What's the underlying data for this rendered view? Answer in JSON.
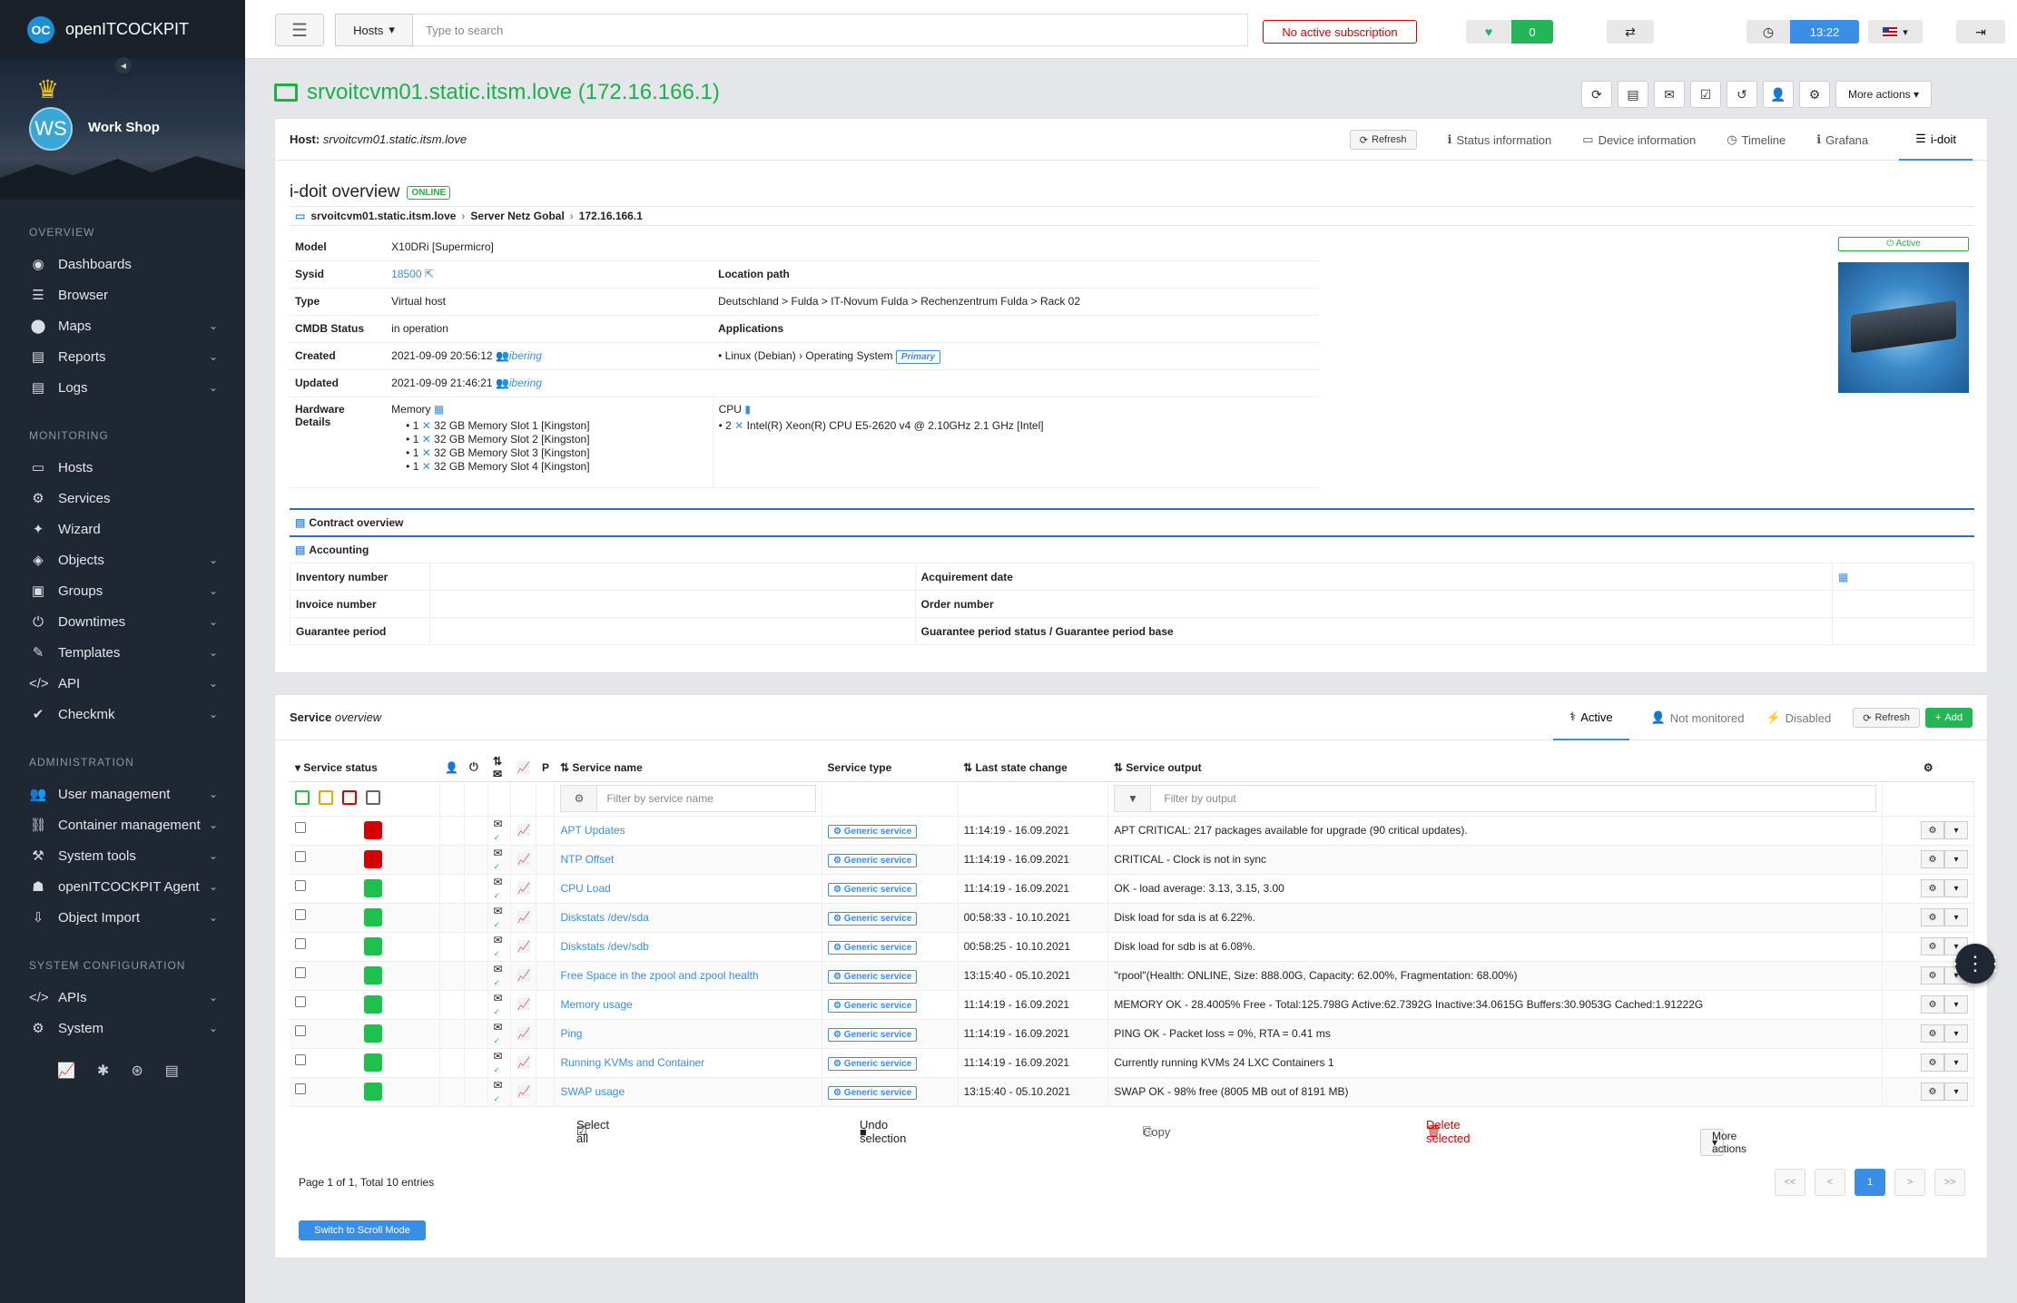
{
  "app": {
    "name": "openITCOCKPIT",
    "logo_text": "OC"
  },
  "user": {
    "initials": "WS",
    "name": "Work Shop"
  },
  "sidebar": {
    "sections": [
      {
        "title": "OVERVIEW",
        "items": [
          {
            "label": "Dashboards",
            "icon": "dashboard-icon",
            "glyph": "◉",
            "expandable": false
          },
          {
            "label": "Browser",
            "icon": "list-icon",
            "glyph": "☰",
            "expandable": false
          },
          {
            "label": "Maps",
            "icon": "map-marker-icon",
            "glyph": "⬤",
            "expandable": true
          },
          {
            "label": "Reports",
            "icon": "file-icon",
            "glyph": "▤",
            "expandable": true
          },
          {
            "label": "Logs",
            "icon": "file-text-icon",
            "glyph": "▤",
            "expandable": true
          }
        ]
      },
      {
        "title": "MONITORING",
        "items": [
          {
            "label": "Hosts",
            "icon": "desktop-icon",
            "glyph": "▭",
            "expandable": false
          },
          {
            "label": "Services",
            "icon": "gears-icon",
            "glyph": "⚙",
            "expandable": false
          },
          {
            "label": "Wizard",
            "icon": "magic-icon",
            "glyph": "✦",
            "expandable": false
          },
          {
            "label": "Objects",
            "icon": "cubes-icon",
            "glyph": "◈",
            "expandable": true
          },
          {
            "label": "Groups",
            "icon": "object-group-icon",
            "glyph": "▣",
            "expandable": true
          },
          {
            "label": "Downtimes",
            "icon": "power-icon",
            "glyph": "⏻",
            "expandable": true
          },
          {
            "label": "Templates",
            "icon": "edit-icon",
            "glyph": "✎",
            "expandable": true
          },
          {
            "label": "API",
            "icon": "code-icon",
            "glyph": "</>",
            "expandable": true
          },
          {
            "label": "Checkmk",
            "icon": "check-icon",
            "glyph": "✔",
            "expandable": true
          }
        ]
      },
      {
        "title": "ADMINISTRATION",
        "items": [
          {
            "label": "User management",
            "icon": "users-icon",
            "glyph": "👥",
            "expandable": true
          },
          {
            "label": "Container management",
            "icon": "link-icon",
            "glyph": "⛓",
            "expandable": true
          },
          {
            "label": "System tools",
            "icon": "tools-icon",
            "glyph": "⚒",
            "expandable": true
          },
          {
            "label": "openITCOCKPIT Agent",
            "icon": "user-secret-icon",
            "glyph": "☗",
            "expandable": true
          },
          {
            "label": "Object Import",
            "icon": "import-icon",
            "glyph": "⇩",
            "expandable": true
          }
        ]
      },
      {
        "title": "SYSTEM CONFIGURATION",
        "items": [
          {
            "label": "APIs",
            "icon": "code-icon",
            "glyph": "</>",
            "expandable": true
          },
          {
            "label": "System",
            "icon": "cogs-icon",
            "glyph": "⚙",
            "expandable": true
          }
        ]
      }
    ],
    "bottom_icons": [
      "chart-icon",
      "bug-icon",
      "support-icon",
      "book-icon"
    ]
  },
  "topbar": {
    "hosts_dropdown": "Hosts",
    "search_placeholder": "Type to search",
    "subscription": "No active subscription",
    "heartbeat_count": "0",
    "time": "13:22"
  },
  "host": {
    "title": "srvoitcvm01.static.itsm.love (172.16.166.1)",
    "label": "Host:",
    "name": "srvoitcvm01.static.itsm.love",
    "more_actions": "More actions"
  },
  "host_tabs": {
    "refresh": "Refresh",
    "items": [
      "Status information",
      "Device information",
      "Timeline",
      "Grafana",
      "i-doit"
    ],
    "active": "i-doit"
  },
  "idoit": {
    "title": "i-doit overview",
    "status": "ONLINE",
    "breadcrumb": [
      "srvoitcvm01.static.itsm.love",
      "Server Netz Gobal",
      "172.16.166.1"
    ],
    "active_label": "Active",
    "model_label": "Model",
    "model": "X10DRi [Supermicro]",
    "sysid_label": "Sysid",
    "sysid": "18500",
    "type_label": "Type",
    "type": "Virtual host",
    "cmdb_label": "CMDB Status",
    "cmdb": "in operation",
    "created_label": "Created",
    "created": "2021-09-09 20:56:12",
    "created_by": "ibering",
    "updated_label": "Updated",
    "updated": "2021-09-09 21:46:21",
    "updated_by": "ibering",
    "hw_label": "Hardware Details",
    "location_label": "Location path",
    "location": "Deutschland > Fulda > IT-Novum Fulda > Rechenzentrum Fulda > Rack 02",
    "applications_label": "Applications",
    "application": "Linux (Debian)",
    "application_type": "Operating System",
    "application_badge": "Primary",
    "memory_label": "Memory",
    "memory": [
      {
        "qty": "1",
        "desc": "32 GB Memory Slot 1 [Kingston]"
      },
      {
        "qty": "1",
        "desc": "32 GB Memory Slot 2 [Kingston]"
      },
      {
        "qty": "1",
        "desc": "32 GB Memory Slot 3 [Kingston]"
      },
      {
        "qty": "1",
        "desc": "32 GB Memory Slot 4 [Kingston]"
      }
    ],
    "cpu_label": "CPU",
    "cpu": {
      "qty": "2",
      "desc": "Intel(R) Xeon(R) CPU E5-2620 v4 @ 2.10GHz 2.1 GHz [Intel]"
    },
    "contract_title": "Contract overview",
    "accounting_title": "Accounting",
    "inventory_label": "Inventory number",
    "acq_label": "Acquirement date",
    "invoice_label": "Invoice number",
    "order_label": "Order number",
    "guarantee_label": "Guarantee period",
    "guarantee_status_label": "Guarantee period status / Guarantee period base"
  },
  "services": {
    "title_a": "Service",
    "title_b": "overview",
    "tabs": [
      "Active",
      "Not monitored",
      "Disabled"
    ],
    "refresh": "Refresh",
    "add": "Add",
    "columns": {
      "status": "Service status",
      "p": "P",
      "name": "Service name",
      "type": "Service type",
      "last": "Last state change",
      "output": "Service output"
    },
    "filter_name_placeholder": "Filter by service name",
    "filter_output_placeholder": "Filter by output",
    "rows": [
      {
        "name": "APT Updates",
        "type": "Generic service",
        "last": "11:14:19 - 16.09.2021",
        "output": "APT CRITICAL: 217 packages available for upgrade (90 critical updates).",
        "state": "critical"
      },
      {
        "name": "NTP Offset",
        "type": "Generic service",
        "last": "11:14:19 - 16.09.2021",
        "output": "CRITICAL - Clock is not in sync",
        "state": "critical"
      },
      {
        "name": "CPU Load",
        "type": "Generic service",
        "last": "11:14:19 - 16.09.2021",
        "output": "OK - load average: 3.13, 3.15, 3.00",
        "state": "ok"
      },
      {
        "name": "Diskstats /dev/sda",
        "type": "Generic service",
        "last": "00:58:33 - 10.10.2021",
        "output": "Disk load for sda is at 6.22%.",
        "state": "ok"
      },
      {
        "name": "Diskstats /dev/sdb",
        "type": "Generic service",
        "last": "00:58:25 - 10.10.2021",
        "output": "Disk load for sdb is at 6.08%.",
        "state": "ok"
      },
      {
        "name": "Free Space in the zpool and zpool health",
        "type": "Generic service",
        "last": "13:15:40 - 05.10.2021",
        "output": "\"rpool\"(Health: ONLINE, Size: 888.00G, Capacity: 62.00%, Fragmentation: 68.00%)",
        "state": "ok"
      },
      {
        "name": "Memory usage",
        "type": "Generic service",
        "last": "11:14:19 - 16.09.2021",
        "output": "MEMORY OK - 28.4005% Free - Total:125.798G Active:62.7392G Inactive:34.0615G Buffers:30.9053G Cached:1.91222G",
        "state": "ok"
      },
      {
        "name": "Ping",
        "type": "Generic service",
        "last": "11:14:19 - 16.09.2021",
        "output": "PING OK - Packet loss = 0%, RTA = 0.41 ms",
        "state": "ok"
      },
      {
        "name": "Running KVMs and Container",
        "type": "Generic service",
        "last": "11:14:19 - 16.09.2021",
        "output": "Currently running KVMs 24 LXC Containers 1",
        "state": "ok"
      },
      {
        "name": "SWAP usage",
        "type": "Generic service",
        "last": "13:15:40 - 05.10.2021",
        "output": "SWAP OK - 98% free (8005 MB out of 8191 MB)",
        "state": "ok"
      }
    ],
    "select_all": "Select all",
    "undo": "Undo selection",
    "copy": "Copy",
    "delete": "Delete selected",
    "more_actions": "More actions",
    "paging": "Page 1 of 1, Total 10 entries",
    "pager": [
      "<<",
      "<",
      "1",
      ">",
      ">>"
    ],
    "scroll_mode": "Switch to Scroll Mode"
  },
  "colors": {
    "ok": "#1fc04c",
    "critical": "#d40000",
    "warning": "#f0a30a",
    "accent": "#3a8ee6"
  }
}
